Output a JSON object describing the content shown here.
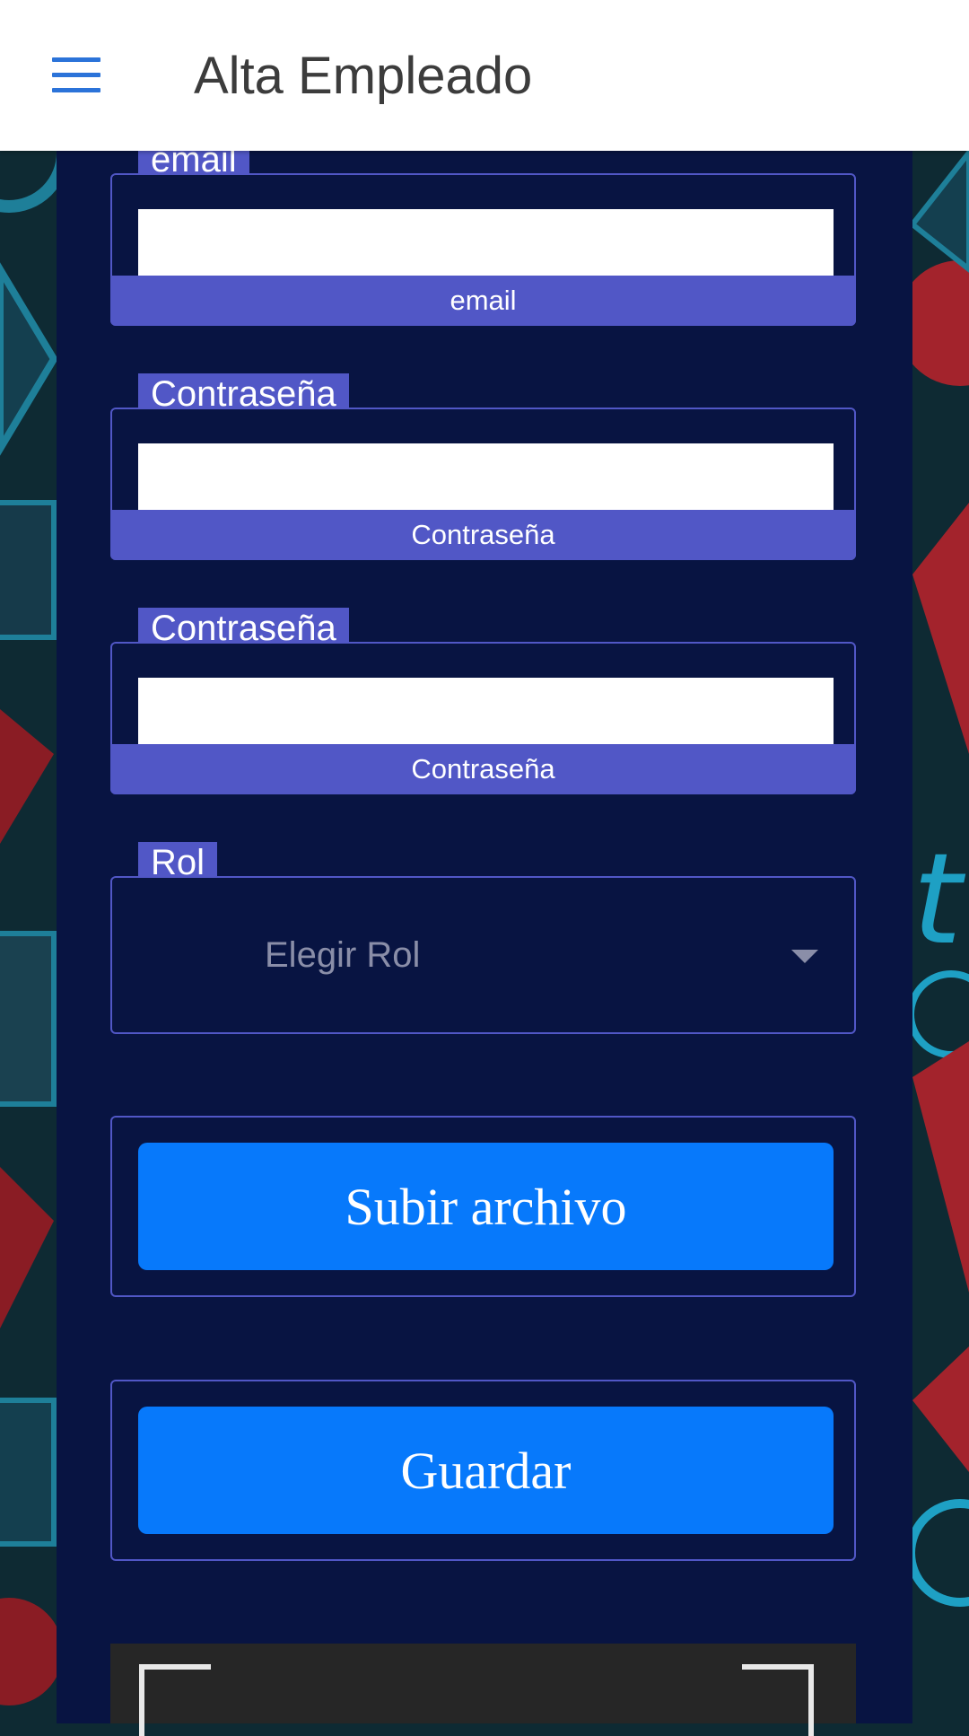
{
  "header": {
    "title": "Alta Empleado",
    "menu_icon": "hamburger-menu-icon",
    "accent_color": "#2b73d9"
  },
  "form": {
    "email": {
      "legend": "email",
      "value": "",
      "helper": "email"
    },
    "password": {
      "legend": "Contraseña",
      "value": "",
      "helper": "Contraseña"
    },
    "password_confirm": {
      "legend": "Contraseña",
      "value": "",
      "helper": "Contraseña"
    },
    "role": {
      "legend": "Rol",
      "selected": "Elegir Rol",
      "icon": "caret-down-icon"
    },
    "upload_button": "Subir archivo",
    "save_button": "Guardar"
  },
  "colors": {
    "panel_bg": "#081442",
    "field_accent": "#5157c6",
    "button_bg": "#0779fb"
  }
}
